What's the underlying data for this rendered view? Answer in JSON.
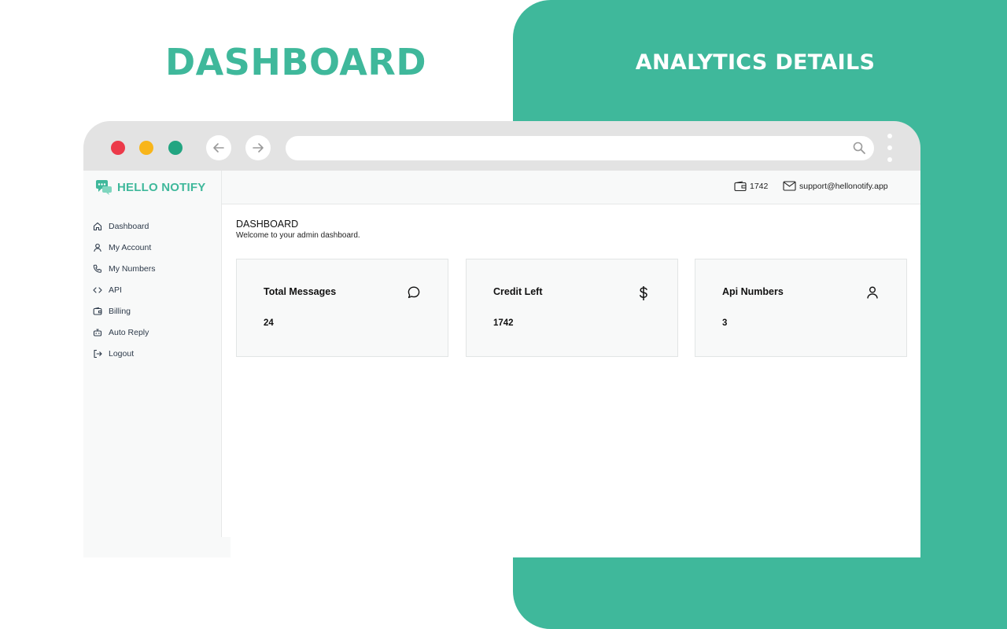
{
  "banner": {
    "left_title": "DASHBOARD",
    "right_title": "ANALYTICS DETAILS"
  },
  "browser": {
    "address_value": ""
  },
  "brand": {
    "name": "HELLO NOTIFY"
  },
  "sidebar": {
    "items": [
      {
        "label": "Dashboard",
        "icon": "home-icon"
      },
      {
        "label": "My Account",
        "icon": "user-icon"
      },
      {
        "label": "My Numbers",
        "icon": "phone-icon"
      },
      {
        "label": "API",
        "icon": "code-icon"
      },
      {
        "label": "Billing",
        "icon": "wallet-icon"
      },
      {
        "label": "Auto Reply",
        "icon": "robot-icon"
      },
      {
        "label": "Logout",
        "icon": "logout-icon"
      }
    ]
  },
  "topbar": {
    "credits": "1742",
    "email": "support@hellonotify.app"
  },
  "main": {
    "title": "DASHBOARD",
    "subtitle": "Welcome to your admin dashboard."
  },
  "cards": [
    {
      "label": "Total Messages",
      "value": "24",
      "icon": "chat-bubble-icon"
    },
    {
      "label": "Credit Left",
      "value": "1742",
      "icon": "dollar-icon"
    },
    {
      "label": "Api Numbers",
      "value": "3",
      "icon": "user-icon"
    }
  ],
  "colors": {
    "accent": "#3fb89b",
    "chrome": "#e3e3e3",
    "dot_red": "#ec3a4a",
    "dot_yellow": "#f8b51a",
    "dot_green": "#22a581"
  }
}
